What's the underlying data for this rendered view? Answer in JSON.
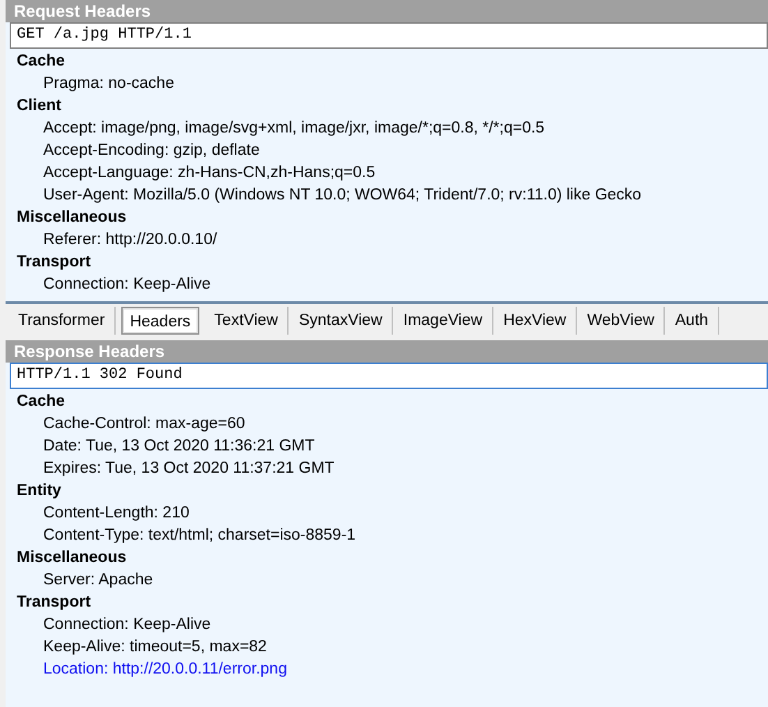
{
  "request": {
    "title": "Request Headers",
    "request_line": "GET /a.jpg HTTP/1.1",
    "groups": [
      {
        "name": "Cache",
        "items": [
          {
            "kind": "header",
            "text": "Pragma: no-cache"
          }
        ]
      },
      {
        "name": "Client",
        "items": [
          {
            "kind": "header",
            "text": "Accept: image/png, image/svg+xml, image/jxr, image/*;q=0.8, */*;q=0.5"
          },
          {
            "kind": "header",
            "text": "Accept-Encoding: gzip, deflate"
          },
          {
            "kind": "header",
            "text": "Accept-Language: zh-Hans-CN,zh-Hans;q=0.5"
          },
          {
            "kind": "header",
            "text": "User-Agent: Mozilla/5.0 (Windows NT 10.0; WOW64; Trident/7.0; rv:11.0) like Gecko"
          }
        ]
      },
      {
        "name": "Miscellaneous",
        "items": [
          {
            "kind": "header",
            "text": "Referer: http://20.0.0.10/"
          }
        ]
      },
      {
        "name": "Transport",
        "items": [
          {
            "kind": "header",
            "text": "Connection: Keep-Alive"
          }
        ]
      }
    ]
  },
  "tabs": [
    {
      "label": "Transformer",
      "selected": false
    },
    {
      "label": "Headers",
      "selected": true
    },
    {
      "label": "TextView",
      "selected": false
    },
    {
      "label": "SyntaxView",
      "selected": false
    },
    {
      "label": "ImageView",
      "selected": false
    },
    {
      "label": "HexView",
      "selected": false
    },
    {
      "label": "WebView",
      "selected": false
    },
    {
      "label": "Auth",
      "selected": false
    }
  ],
  "response": {
    "title": "Response Headers",
    "status_line": "HTTP/1.1 302 Found",
    "groups": [
      {
        "name": "Cache",
        "items": [
          {
            "kind": "header",
            "text": "Cache-Control: max-age=60"
          },
          {
            "kind": "header",
            "text": "Date: Tue, 13 Oct 2020 11:36:21 GMT"
          },
          {
            "kind": "header",
            "text": "Expires: Tue, 13 Oct 2020 11:37:21 GMT"
          }
        ]
      },
      {
        "name": "Entity",
        "items": [
          {
            "kind": "header",
            "text": "Content-Length: 210"
          },
          {
            "kind": "header",
            "text": "Content-Type: text/html; charset=iso-8859-1"
          }
        ]
      },
      {
        "name": "Miscellaneous",
        "items": [
          {
            "kind": "header",
            "text": "Server: Apache"
          }
        ]
      },
      {
        "name": "Transport",
        "items": [
          {
            "kind": "header",
            "text": "Connection: Keep-Alive"
          },
          {
            "kind": "header",
            "text": "Keep-Alive: timeout=5, max=82"
          },
          {
            "kind": "link",
            "text": "Location: http://20.0.0.11/error.png"
          }
        ]
      }
    ]
  }
}
